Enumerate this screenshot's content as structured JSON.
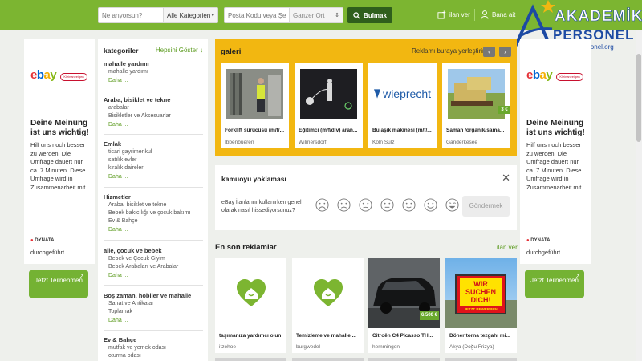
{
  "header": {
    "search_placeholder": "Ne arıyorsun?",
    "category_value": "Alle Kategorien",
    "zip_placeholder": "Posta Kodu veya Şehir",
    "place_value": "Ganzer Ort",
    "search_button": "Bulmak",
    "post_ad": "ilan ver",
    "account": "Bana ait"
  },
  "watermark": {
    "title": "AKADEMİK",
    "sub": "PERSONEL",
    "url": "akademikpersonel.org"
  },
  "ad": {
    "logo": "ebay",
    "badge": "Kleinanzeigen",
    "heading": "Deine Meinung ist uns wichtig!",
    "text": "Hilf uns noch besser zu werden. Die Umfrage dauert nur ca. 7 Minuten. Diese Umfrage wird in Zusammenarbeit mit",
    "brand": "DYNATA",
    "text2": "durchgeführt",
    "button": "Jetzt Teilnehmen"
  },
  "sidebar": {
    "title": "kategoriler",
    "toggle": "Hepsini Göster ↓",
    "more": "Daha ...",
    "groups": [
      {
        "h": "mahalle yardımı",
        "items": [
          "mahalle yardımı"
        ]
      },
      {
        "h": "Araba, bisiklet ve tekne",
        "items": [
          "arabalar",
          "Bisikletler ve Aksesuarlar"
        ]
      },
      {
        "h": "Emlak",
        "items": [
          "ticari gayrimenkul",
          "satılık evler",
          "kiralık daireler"
        ]
      },
      {
        "h": "Hizmetler",
        "items": [
          "Araba, bisiklet ve tekne",
          "Bebek bakıcılığı ve çocuk bakımı",
          "Ev & Bahçe"
        ]
      },
      {
        "h": "aile, çocuk ve bebek",
        "items": [
          "Bebek ve Çocuk Giyim",
          "Bebek Arabaları ve Arabalar"
        ]
      },
      {
        "h": "Boş zaman, hobiler ve mahalle",
        "items": [
          "Sanat ve Antikalar",
          "Toplamak"
        ]
      },
      {
        "h": "Ev & Bahçe",
        "items": [
          "mutfak ve yemek odası",
          "oturma odası"
        ]
      }
    ]
  },
  "gallery": {
    "title": "galeri",
    "ad_link": "Reklamı buraya yerleştirin",
    "cards": [
      {
        "title": "Forklift sürücüsü (m/f/...",
        "loc": "Ibbenbueren"
      },
      {
        "title": "Eğitimci (m/f/div) aran...",
        "loc": "Wilmersdorf"
      },
      {
        "title": "Bulaşık makinesi (m/f/...",
        "loc": "Köln Sulz",
        "logo": "wieprecht"
      },
      {
        "title": "Saman /organik/sama...",
        "loc": "Ganderkesee",
        "price": "3 €"
      }
    ]
  },
  "poll": {
    "title": "kamuoyu yoklaması",
    "question": "eBay İlanlarını kullanırken genel olarak nasıl hissediyorsunuz?",
    "button": "Göndermek"
  },
  "latest": {
    "title": "En son reklamlar",
    "all": "ilan ver",
    "cards": [
      {
        "title": "taşımanıza yardımcı olun",
        "loc": "itzehoe"
      },
      {
        "title": "Temizleme ve mahalle ...",
        "loc": "burgwedel"
      },
      {
        "title": "Citroën C4 Picasso TH...",
        "loc": "hemmingen",
        "price": "6.500 €"
      },
      {
        "title": "Döner torna tezgahı mi...",
        "loc": "Akya (Doğu Frizya)",
        "sign": "WIR SUCHEN DICH!",
        "sign_sub": "JETZT BEWERBEN"
      }
    ]
  },
  "colors": {
    "brand_green": "#7cb531",
    "gallery_yellow": "#f2b711",
    "watermark_blue": "#1c4aa3"
  }
}
